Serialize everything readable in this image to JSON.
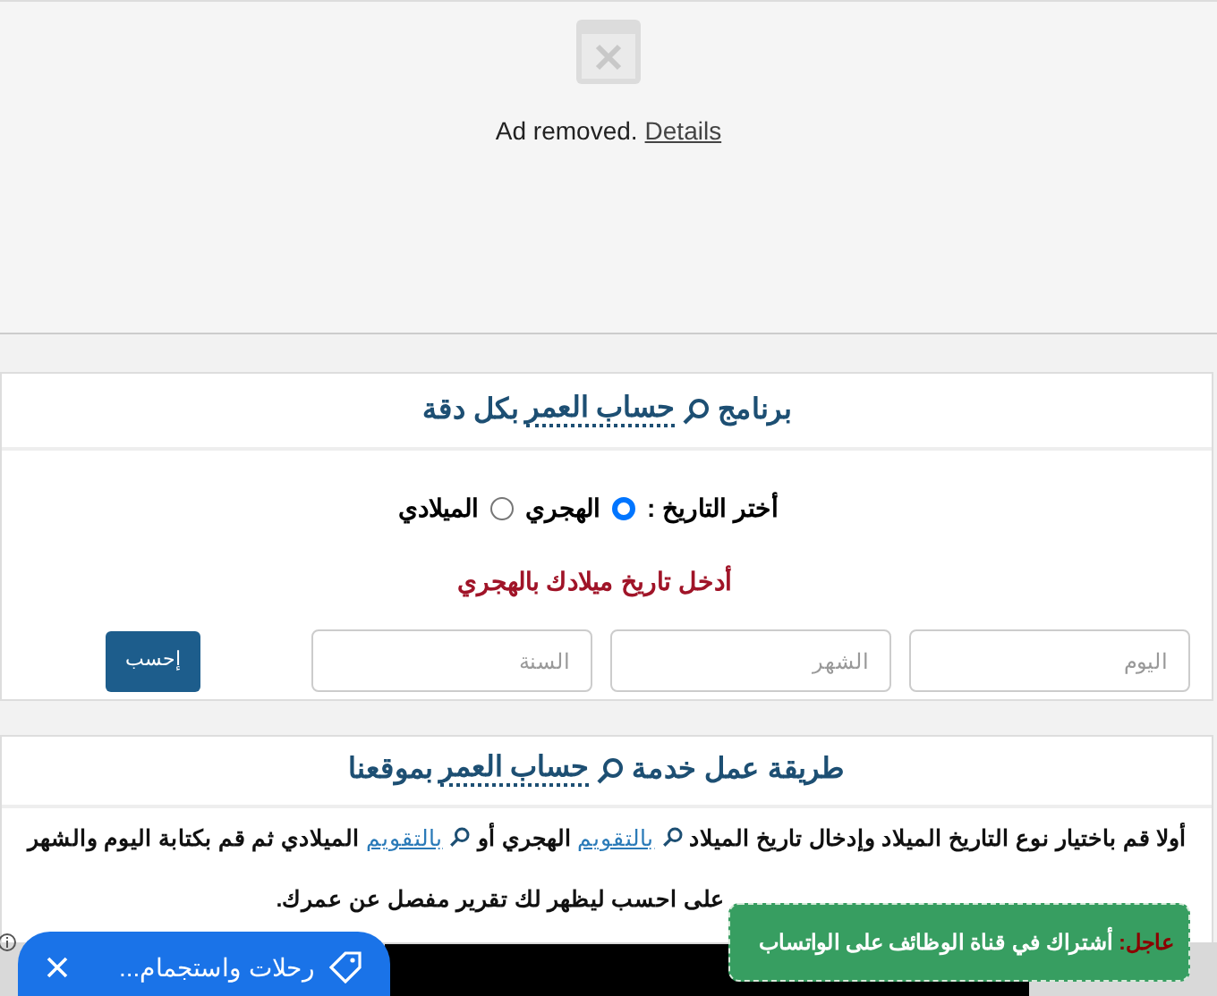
{
  "ad": {
    "text": "Ad removed.",
    "link": "Details"
  },
  "calculator": {
    "title": {
      "before": "برنامج",
      "link": "حساب العمر",
      "after": "بكل دقة"
    },
    "date_type": {
      "label": "أختر التاريخ :",
      "options": [
        {
          "label": "الهجري",
          "selected": true
        },
        {
          "label": "الميلادي",
          "selected": false
        }
      ]
    },
    "prompt": "أدخل تاريخ ميلادك بالهجري",
    "fields": [
      {
        "placeholder": "اليوم"
      },
      {
        "placeholder": "الشهر"
      },
      {
        "placeholder": "السنة"
      }
    ],
    "button": "إحسب"
  },
  "how_it_works": {
    "title": {
      "before": "طريقة عمل خدمة",
      "link": "حساب العمر",
      "after": "بموقعنا"
    },
    "paragraph": [
      {
        "kind": "text",
        "text": "أولا قم باختيار نوع التاريخ الميلاد وإدخال تاريخ الميلاد "
      },
      {
        "kind": "link",
        "text": "بالتقويم"
      },
      {
        "kind": "text",
        "text": " الهجري أو "
      },
      {
        "kind": "link",
        "text": "بالتقويم"
      },
      {
        "kind": "text",
        "text": " الميلادي ثم قم بكتابة اليوم والشهر"
      },
      {
        "kind": "break"
      },
      {
        "kind": "text",
        "text": "على احسب ليظهر لك تقرير مفصل عن عمرك."
      }
    ]
  },
  "sticky_pill": {
    "text": "رحلات واستجمام..."
  },
  "toast": {
    "label": "عاجل:",
    "text": "أشتراك في قناة الوظائف على الواتساب"
  }
}
